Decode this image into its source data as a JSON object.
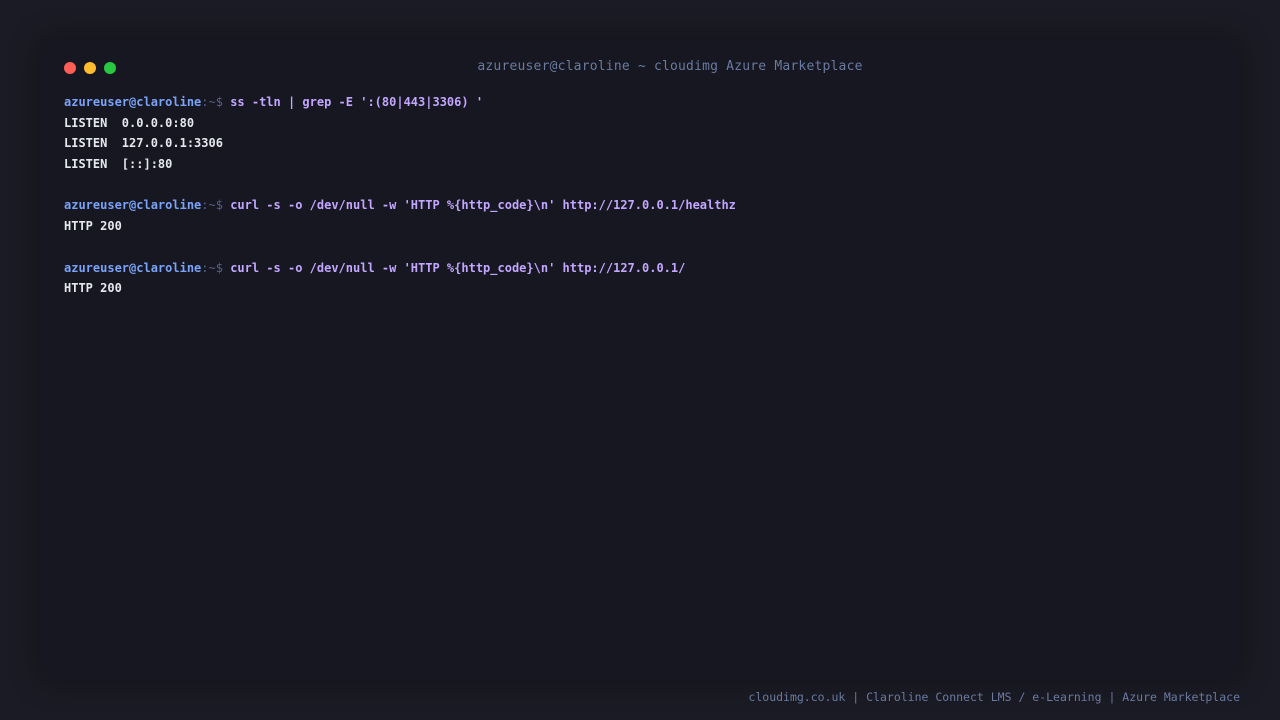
{
  "window": {
    "title": "azureuser@claroline ~ cloudimg Azure Marketplace",
    "controls": {
      "close_color": "#ff5f57",
      "minimize_color": "#febc2e",
      "maximize_color": "#28c840"
    }
  },
  "terminal": {
    "prompt_user": "azureuser@claroline",
    "prompt_suffix": ":~$ ",
    "blocks": [
      {
        "command": "ss -tln | grep -E ':(80|443|3306) '",
        "output": [
          "LISTEN  0.0.0.0:80",
          "LISTEN  127.0.0.1:3306",
          "LISTEN  [::]:80"
        ]
      },
      {
        "command": "curl -s -o /dev/null -w 'HTTP %{http_code}\\n' http://127.0.0.1/healthz",
        "output": [
          "HTTP 200"
        ]
      },
      {
        "command": "curl -s -o /dev/null -w 'HTTP %{http_code}\\n' http://127.0.0.1/",
        "output": [
          "HTTP 200"
        ]
      }
    ]
  },
  "footer": {
    "text": "cloudimg.co.uk | Claroline Connect LMS / e-Learning | Azure Marketplace"
  },
  "colors": {
    "background": "#1b1b25",
    "terminal_bg": "#161720",
    "prompt_user": "#7aa2f7",
    "command": "#c3a6ff",
    "output": "#e6e8f0"
  }
}
